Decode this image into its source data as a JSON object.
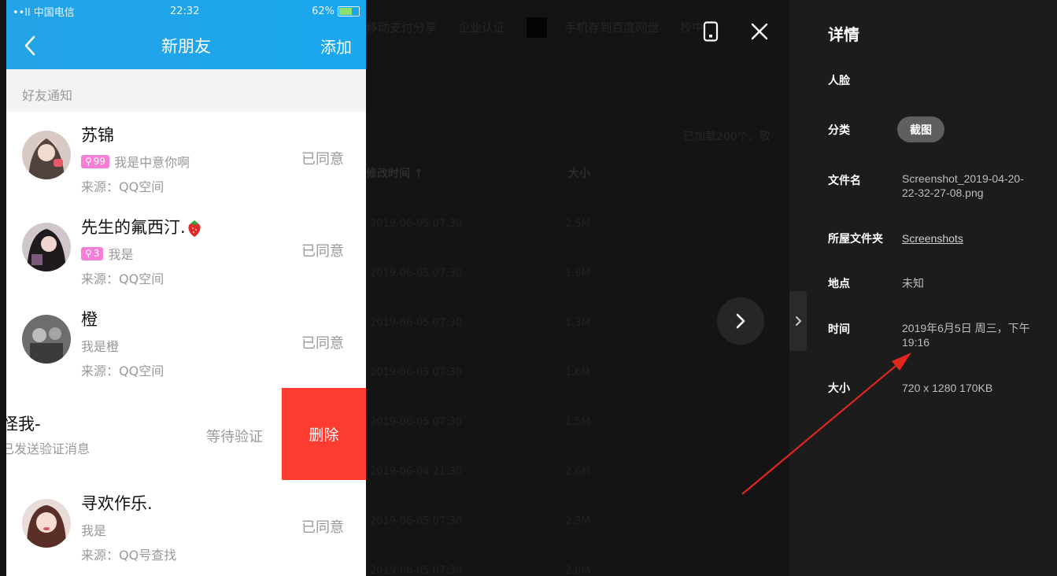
{
  "background": {
    "top_items": [
      "移动支付分享",
      "企业认证",
      "手机存到百度网盘",
      "校中"
    ],
    "count_text": "已加载200个，敬",
    "col_time": "修改时间 ↑",
    "col_size": "大小",
    "rows": [
      {
        "time": "2019-06-05 07:30",
        "size": "2.5M"
      },
      {
        "time": "2019-06-05 07:30",
        "size": "1.6M"
      },
      {
        "time": "2019-06-05 07:30",
        "size": "1.3M"
      },
      {
        "time": "2019-06-05 07:30",
        "size": "1.6M"
      },
      {
        "time": "2019-06-05 07:30",
        "size": "1.5M"
      },
      {
        "time": "2019-06-04 21:30",
        "size": "2.6M"
      },
      {
        "time": "2019-06-05 07:30",
        "size": "2.3M"
      },
      {
        "time": "2019-06-05 07:30",
        "size": "2.0M"
      }
    ]
  },
  "phone": {
    "status": {
      "carrier": "••ll 中国电信",
      "time": "22:32",
      "battery": "62%"
    },
    "nav": {
      "title": "新朋友",
      "add": "添加"
    },
    "section": "好友通知",
    "rows": [
      {
        "name": "苏锦",
        "badge": "99",
        "message": "我是中意你啊",
        "source": "来源：QQ空间",
        "status": "已同意"
      },
      {
        "name": "先生的氟西汀.",
        "badge": "3",
        "message": "我是",
        "source": "来源：QQ空间",
        "status": "已同意"
      },
      {
        "name": "橙",
        "message": "我是橙",
        "source": "来源：QQ空间",
        "status": "已同意"
      },
      {
        "name": "寻欢作乐.",
        "message": "我是",
        "source": "来源：QQ号查找",
        "status": "已同意"
      }
    ],
    "swiped": {
      "name": "怪我-",
      "message": "已发送验证消息",
      "status": "等待验证",
      "delete": "删除"
    }
  },
  "panel": {
    "title": "详情",
    "face_label": "人脸",
    "category_label": "分类",
    "category_value": "截图",
    "filename_label": "文件名",
    "filename_line1": "Screenshot_2019-04-20-",
    "filename_line2": "22-32-27-08.png",
    "folder_label": "所屋文件夹",
    "folder_value": "Screenshots",
    "location_label": "地点",
    "location_value": "未知",
    "time_label": "时间",
    "time_line1": "2019年6月5日 周三，下午",
    "time_line2": "19:16",
    "size_label": "大小",
    "size_value": "720 x 1280 170KB"
  },
  "colors": {
    "panel_bg": "#1c1c1c",
    "delete": "#fe3b30",
    "header": "#1aa7ee",
    "arrow": "#e0261e",
    "badge": "#f67ed4"
  },
  "icons": [
    "back-arrow-icon",
    "phone-view-icon",
    "close-icon",
    "chevron-right-icon",
    "collapse-panel-icon",
    "strawberry-icon"
  ]
}
